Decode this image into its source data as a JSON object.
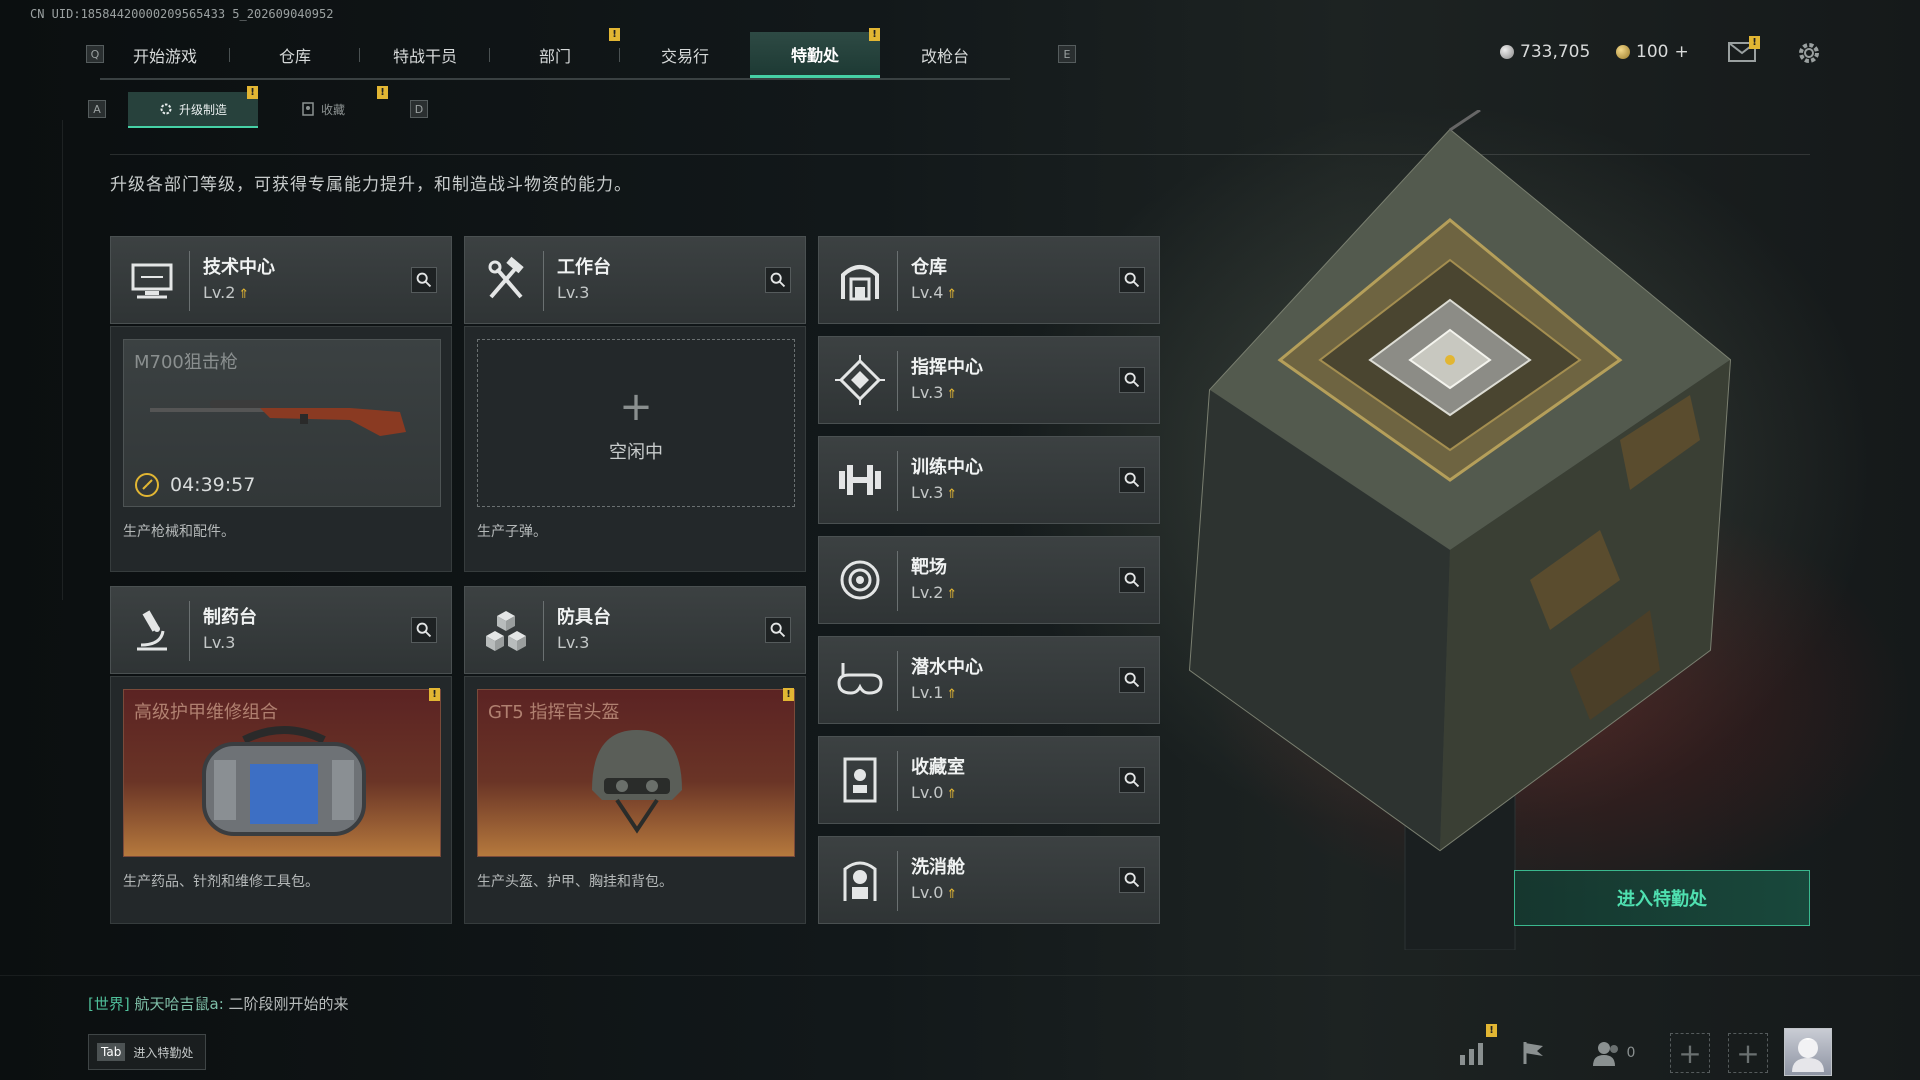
{
  "uid_text": "CN UID:18584420000209565433 5_202609040952",
  "keys": {
    "q": "Q",
    "e": "E",
    "a": "A",
    "d": "D"
  },
  "nav": {
    "tabs": [
      {
        "label": "开始游戏"
      },
      {
        "label": "仓库"
      },
      {
        "label": "特战干员"
      },
      {
        "label": "部门"
      },
      {
        "label": "交易行"
      },
      {
        "label": "特勤处"
      },
      {
        "label": "改枪台"
      }
    ],
    "active_tab": "特勤处",
    "badge": "!"
  },
  "currency": {
    "coins": "733,705",
    "tickets": "100",
    "plus": "+"
  },
  "subnav": {
    "upgrade": "升级制造",
    "collect": "收藏"
  },
  "description": "升级各部门等级，可获得专属能力提升，和制造战斗物资的能力。",
  "workshops": {
    "tech": {
      "name": "技术中心",
      "level": "Lv.2",
      "product": "M700狙击枪",
      "timer": "04:39:57",
      "desc": "生产枪械和配件。"
    },
    "bench": {
      "name": "工作台",
      "level": "Lv.3",
      "idle_plus": "+",
      "idle": "空闲中",
      "desc": "生产子弹。"
    },
    "pharmacy": {
      "name": "制药台",
      "level": "Lv.3",
      "product": "高级护甲维修组合",
      "desc": "生产药品、针剂和维修工具包。"
    },
    "armor": {
      "name": "防具台",
      "level": "Lv.3",
      "product": "GT5 指挥官头盔",
      "desc": "生产头盔、护甲、胸挂和背包。"
    }
  },
  "departments": [
    {
      "name": "仓库",
      "level": "Lv.4",
      "icon": "warehouse-icon"
    },
    {
      "name": "指挥中心",
      "level": "Lv.3",
      "icon": "command-icon"
    },
    {
      "name": "训练中心",
      "level": "Lv.3",
      "icon": "dumbbell-icon"
    },
    {
      "name": "靶场",
      "level": "Lv.2",
      "icon": "target-icon"
    },
    {
      "name": "潜水中心",
      "level": "Lv.1",
      "icon": "diving-mask-icon"
    },
    {
      "name": "收藏室",
      "level": "Lv.0",
      "icon": "display-case-icon"
    },
    {
      "name": "洗消舱",
      "level": "Lv.0",
      "icon": "hazmat-icon"
    }
  ],
  "enter_button": "进入特勤处",
  "chat": {
    "channel": "[世界]",
    "sender": "航天哈吉鼠a:",
    "message": "二阶段刚开始的来"
  },
  "tab_hint": {
    "key": "Tab",
    "label": "进入特勤处"
  },
  "friends_count": "0",
  "colors": {
    "accent": "#46d1a6",
    "badge": "#e2b633",
    "enter_text": "#4fe0b0"
  }
}
